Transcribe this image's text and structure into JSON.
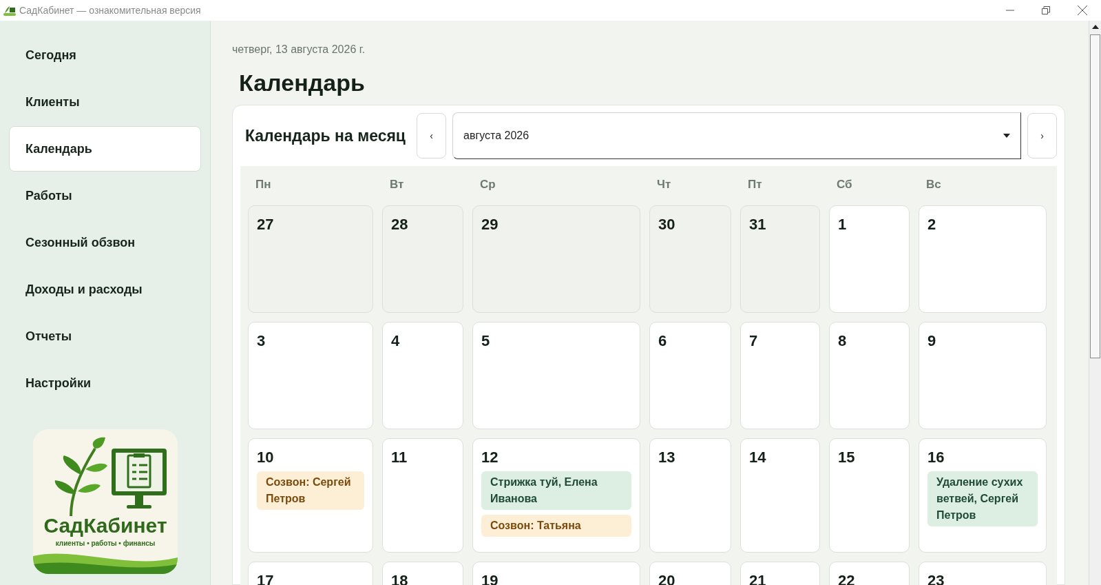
{
  "window": {
    "title": "СадКабинет — ознакомительная версия"
  },
  "sidebar": {
    "items": [
      {
        "label": "Сегодня",
        "selected": false
      },
      {
        "label": "Клиенты",
        "selected": false
      },
      {
        "label": "Календарь",
        "selected": true
      },
      {
        "label": "Работы",
        "selected": false
      },
      {
        "label": "Сезонный обзвон",
        "selected": false
      },
      {
        "label": "Доходы и расходы",
        "selected": false
      },
      {
        "label": "Отчеты",
        "selected": false
      },
      {
        "label": "Настройки",
        "selected": false
      }
    ],
    "logo": {
      "name": "СадКабинет",
      "tagline": "клиенты • работы • финансы"
    }
  },
  "date": "четверг, 13 августа 2026 г.",
  "heading": "Календарь",
  "calendar": {
    "title": "Календарь на месяц",
    "prev": "‹",
    "month": "августа 2026",
    "next": "›",
    "weekdays": [
      "Пн",
      "Вт",
      "Ср",
      "Чт",
      "Пт",
      "Сб",
      "Вс"
    ],
    "weeks": [
      [
        {
          "day": "27",
          "outside": true
        },
        {
          "day": "28",
          "outside": true
        },
        {
          "day": "29",
          "outside": true
        },
        {
          "day": "30",
          "outside": true
        },
        {
          "day": "31",
          "outside": true
        },
        {
          "day": "1",
          "outside": false
        },
        {
          "day": "2",
          "outside": false
        }
      ],
      [
        {
          "day": "3",
          "outside": false
        },
        {
          "day": "4",
          "outside": false
        },
        {
          "day": "5",
          "outside": false
        },
        {
          "day": "6",
          "outside": false
        },
        {
          "day": "7",
          "outside": false
        },
        {
          "day": "8",
          "outside": false
        },
        {
          "day": "9",
          "outside": false
        }
      ],
      [
        {
          "day": "10",
          "outside": false,
          "events": [
            {
              "kind": "call",
              "text": "Созвон: Сергей Петров"
            }
          ]
        },
        {
          "day": "11",
          "outside": false
        },
        {
          "day": "12",
          "outside": false,
          "events": [
            {
              "kind": "work",
              "text": "Стрижка туй, Елена Иванова"
            },
            {
              "kind": "call",
              "text": "Созвон: Татьяна"
            }
          ]
        },
        {
          "day": "13",
          "outside": false
        },
        {
          "day": "14",
          "outside": false
        },
        {
          "day": "15",
          "outside": false
        },
        {
          "day": "16",
          "outside": false,
          "events": [
            {
              "kind": "work",
              "text": "Удаление сухих ветвей, Сергей Петров"
            }
          ]
        }
      ],
      [
        {
          "day": "17",
          "outside": false
        },
        {
          "day": "18",
          "outside": false
        },
        {
          "day": "19",
          "outside": false
        },
        {
          "day": "20",
          "outside": false
        },
        {
          "day": "21",
          "outside": false
        },
        {
          "day": "22",
          "outside": false
        },
        {
          "day": "23",
          "outside": false
        }
      ]
    ]
  }
}
